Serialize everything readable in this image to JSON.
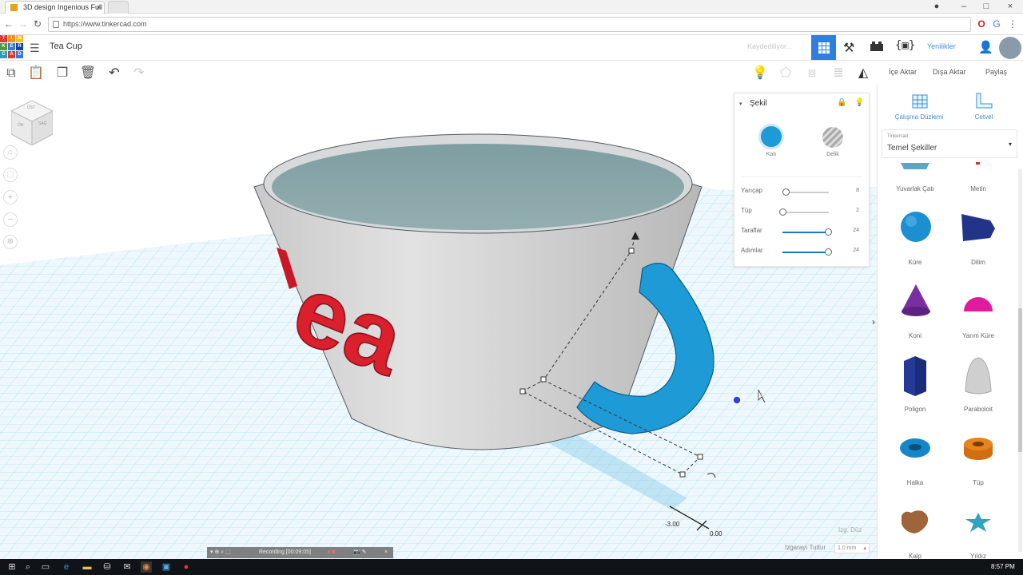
{
  "browser": {
    "tab_title": "3D design Ingenious Full",
    "url": "https://www.tinkercad.com"
  },
  "app": {
    "logo_letters": [
      "T",
      "I",
      "N",
      "K",
      "E",
      "R",
      "C",
      "A",
      "D"
    ],
    "design_title": "Tea Cup",
    "saving_status": "Kaydediliyor...",
    "whats_new": "Yenilikler"
  },
  "toolbar": {
    "import": "İçe Aktar",
    "export": "Dışa Aktar",
    "share": "Paylaş"
  },
  "viewcube": {
    "top": "ÜST",
    "front": "ÖN",
    "right": "SAĞ"
  },
  "inspector": {
    "title": "Şekil",
    "solid_label": "Katı",
    "hole_label": "Delik",
    "params": [
      {
        "label": "Yarıçap",
        "value": "8",
        "fraction": 0.0
      },
      {
        "label": "Tüp",
        "value": "2",
        "fraction": 0.0
      },
      {
        "label": "Taraflar",
        "value": "24",
        "fraction": 1.0
      },
      {
        "label": "Adımlar",
        "value": "24",
        "fraction": 1.0
      }
    ]
  },
  "cup_text": "ea",
  "dimensions": {
    "a": "-3.00",
    "b": "0.00"
  },
  "grid": {
    "edit_grid": "Izg. Düz",
    "snap_label": "Izgarayı Tuttur",
    "snap_value": "1.0 mm"
  },
  "right_panel": {
    "workplane": "Çalışma Düzlemi",
    "ruler": "Cetvel",
    "library_source": "Tinkercad",
    "library_name": "Temel Şekiller",
    "shapes": [
      {
        "label": "Yuvarlak Çatı",
        "icon": "round-roof-icon",
        "color": "#5aa6c9"
      },
      {
        "label": "Metin",
        "icon": "text-icon",
        "color": "#d92b2b"
      },
      {
        "label": "Küre",
        "icon": "sphere-icon",
        "color": "#1b8fd1"
      },
      {
        "label": "Dilim",
        "icon": "wedge-icon",
        "color": "#22348a"
      },
      {
        "label": "Koni",
        "icon": "cone-icon",
        "color": "#7a2fa0"
      },
      {
        "label": "Yarım Küre",
        "icon": "half-sphere-icon",
        "color": "#e21aa0"
      },
      {
        "label": "Poligon",
        "icon": "polygon-icon",
        "color": "#253a96"
      },
      {
        "label": "Paraboloit",
        "icon": "paraboloid-icon",
        "color": "#cfcfcf"
      },
      {
        "label": "Halka",
        "icon": "torus-icon",
        "color": "#1586c9"
      },
      {
        "label": "Tüp",
        "icon": "tube-icon",
        "color": "#e8831e"
      },
      {
        "label": "Kalp",
        "icon": "heart-icon",
        "color": "#a0643a"
      },
      {
        "label": "Yıldız",
        "icon": "star-icon",
        "color": "#2fa3c2"
      }
    ]
  },
  "recording": {
    "label": "Recording [00:09:05]"
  },
  "taskbar": {
    "clock": "8:57 PM"
  },
  "colors": {
    "tinkercad_blue": "#2f7fe0",
    "handle_blue": "#1e9ad6",
    "text_red": "#d9202c",
    "grid_line": "#b8e0f2"
  }
}
